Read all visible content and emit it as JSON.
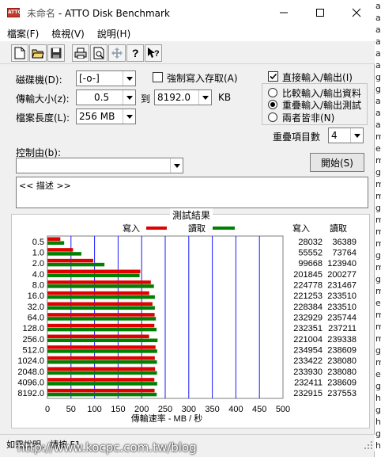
{
  "window": {
    "title_doc": "未命名",
    "title_sep": " - ",
    "title_app": "ATTO Disk Benchmark"
  },
  "menu": {
    "items": [
      "檔案(F)",
      "檢視(V)",
      "說明(H)"
    ]
  },
  "toolbar": {
    "icons": [
      "new-icon",
      "open-icon",
      "save-icon",
      "print-icon",
      "print-preview-icon",
      "move-icon",
      "help-icon",
      "context-help-icon"
    ]
  },
  "settings": {
    "drive_label": "磁碟機(D):",
    "drive_value": "[-o-]",
    "force_write_label": "強制寫入存取(A)",
    "force_write_checked": false,
    "direct_io_label": "直接輸入/輸出(I)",
    "direct_io_checked": true,
    "transfer_label": "傳輸大小(z):",
    "transfer_from": "0.5",
    "to_label": "到",
    "transfer_to": "8192.0",
    "unit_label": "KB",
    "file_length_label": "檔案長度(L):",
    "file_length_value": "256 MB",
    "io_modes": [
      "比較輸入/輸出資料",
      "重疊輸入/輸出測試",
      "兩者皆非(N)"
    ],
    "io_mode_selected": 1,
    "queue_label": "重疊項目數",
    "queue_value": "4",
    "controlled_by_label": "控制由(b):",
    "controlled_by_value": "",
    "start_button": "開始(S)",
    "description": "<< 描述 >>"
  },
  "results": {
    "title": "測試結果",
    "legend_write": "寫入",
    "legend_read": "讀取",
    "col_write": "寫入",
    "col_read": "讀取",
    "write_color": "#e00000",
    "read_color": "#008000"
  },
  "chart_data": {
    "type": "bar",
    "orientation": "horizontal",
    "categories": [
      "0.5",
      "1.0",
      "2.0",
      "4.0",
      "8.0",
      "16.0",
      "32.0",
      "64.0",
      "128.0",
      "256.0",
      "512.0",
      "1024.0",
      "2048.0",
      "4096.0",
      "8192.0"
    ],
    "series": [
      {
        "name": "寫入",
        "values": [
          28032,
          55552,
          99668,
          201845,
          224778,
          221253,
          228384,
          232929,
          232351,
          221004,
          234954,
          233422,
          233930,
          232411,
          232915
        ]
      },
      {
        "name": "讀取",
        "values": [
          36389,
          73764,
          123940,
          200277,
          231467,
          233510,
          233510,
          235744,
          237211,
          239338,
          238609,
          238080,
          238080,
          238609,
          237553
        ]
      }
    ],
    "x_ticks": [
      "0",
      "50",
      "100",
      "150",
      "200",
      "250",
      "300",
      "350",
      "400",
      "450",
      "500"
    ],
    "xlabel": "傳輸速率 - MB / 秒",
    "xlim": [
      0,
      500
    ]
  },
  "status": {
    "text": "如需說明，請按 F1"
  },
  "background": {
    "letters": [
      "a",
      "a",
      "a",
      "a",
      "a",
      "a",
      "g",
      "g",
      "a",
      "a",
      "a",
      "m",
      "e",
      "m",
      "g",
      "m",
      "m",
      "g",
      "m",
      "m",
      "m",
      "g",
      "m",
      "g",
      "m",
      "e",
      "m",
      "m",
      "m",
      "g",
      "m",
      "e",
      "g",
      "h",
      "g",
      "h",
      "g",
      "h"
    ]
  },
  "watermark": "http://www.kocpc.com.tw/blog"
}
